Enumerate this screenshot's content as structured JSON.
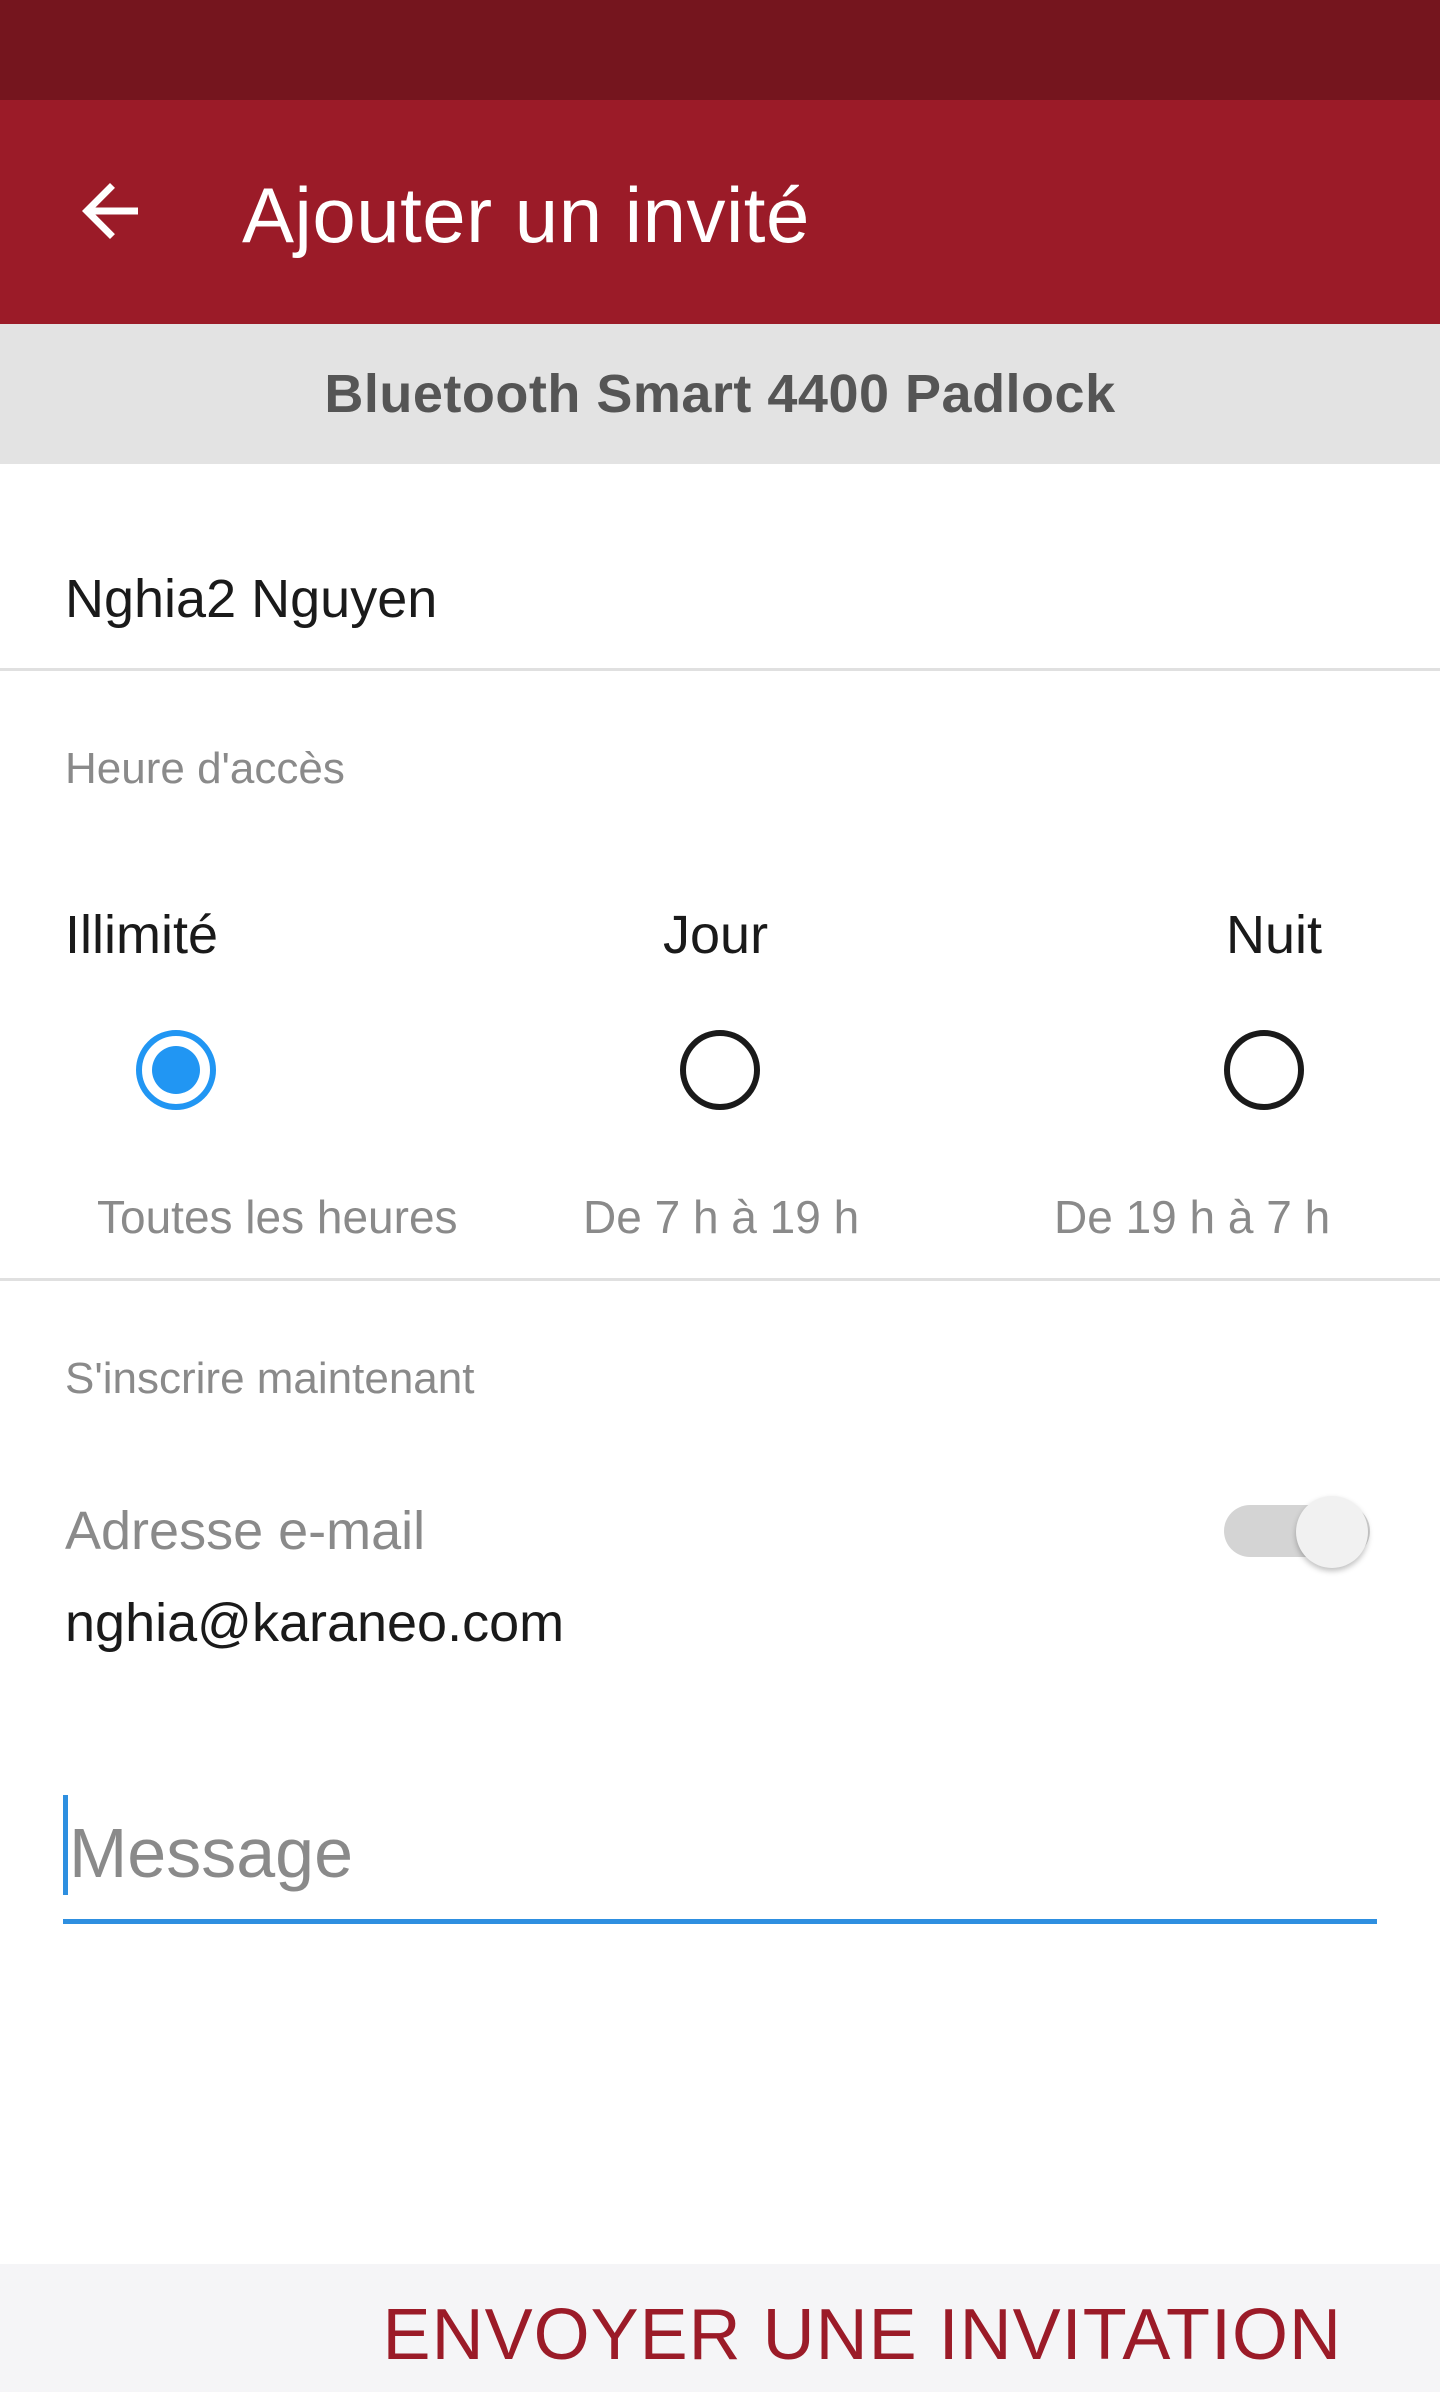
{
  "app_bar": {
    "title": "Ajouter un invité",
    "back_icon": "arrow-back-icon",
    "color": "#9b1b28",
    "status_bar_color": "#75151e"
  },
  "device": {
    "name": "Bluetooth Smart 4400 Padlock"
  },
  "guest": {
    "name": "Nghia2 Nguyen"
  },
  "access_time": {
    "label": "Heure d'accès",
    "options": [
      {
        "title": "Illimité",
        "subtitle": "Toutes les heures",
        "selected": true
      },
      {
        "title": "Jour",
        "subtitle": "De 7 h à 19 h",
        "selected": false
      },
      {
        "title": "Nuit",
        "subtitle": "De 19 h à 7 h",
        "selected": false
      }
    ]
  },
  "enroll": {
    "label": "S'inscrire maintenant",
    "email_label": "Adresse e-mail",
    "email_value": "nghia@karaneo.com",
    "toggle_on": false
  },
  "message": {
    "placeholder": "Message",
    "value": "",
    "accent": "#2e8fe0"
  },
  "actions": {
    "send_label": "ENVOYER UNE INVITATION"
  }
}
